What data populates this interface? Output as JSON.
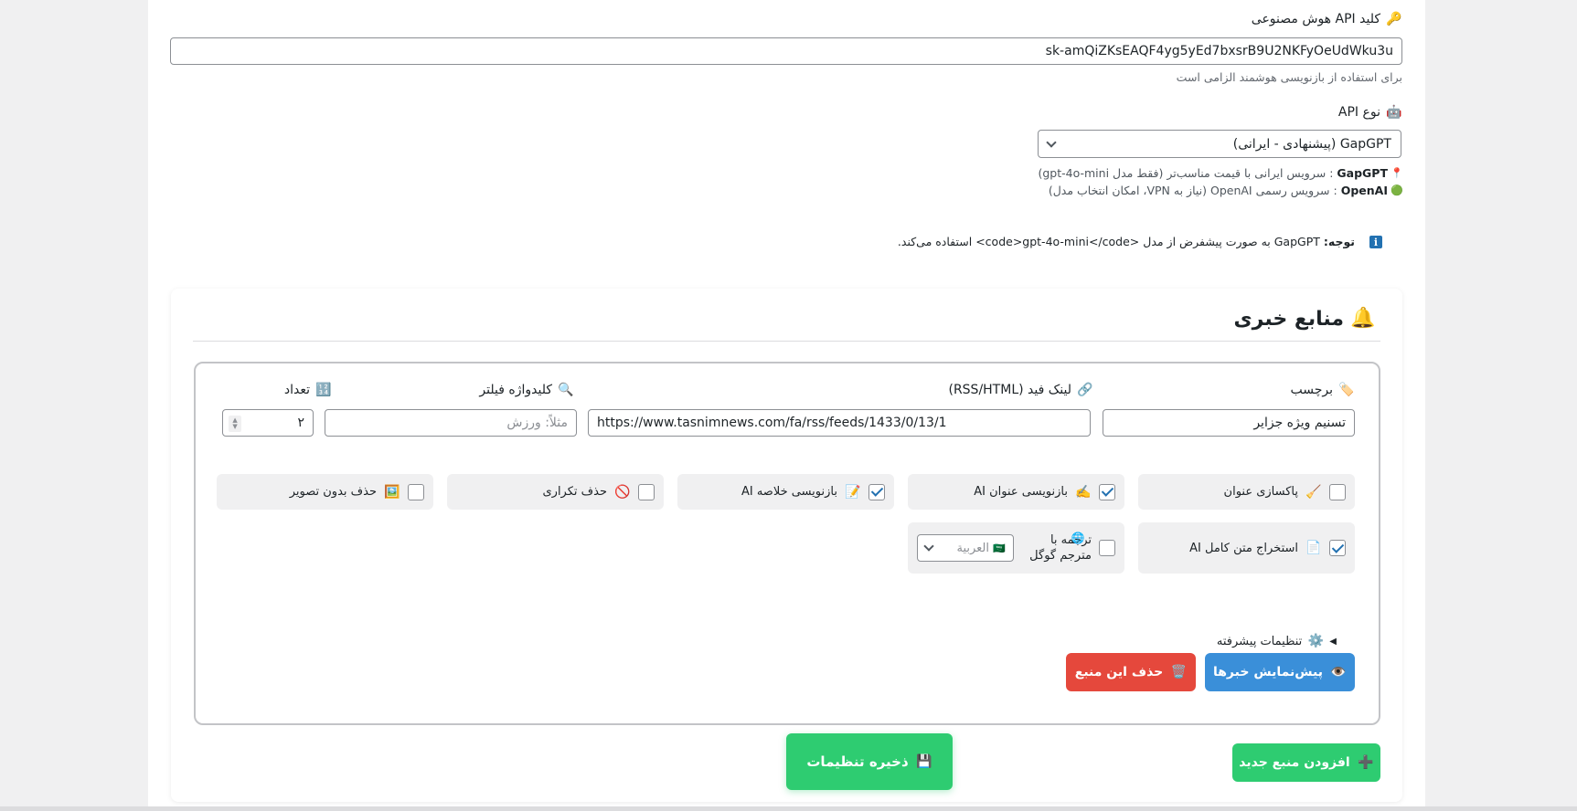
{
  "api_key": {
    "label": "کلید API هوش مصنوعی",
    "icon": "key-icon",
    "value": "sk-amQiZKsEAQF4yg5yEd7bxsrB9U2NKFyOeUdWku3u",
    "help": "برای استفاده از بازنویسی هوشمند الزامی است"
  },
  "api_type": {
    "label": "نوع API",
    "icon": "robot-icon",
    "selected": "GapGPT (پیشنهادی - ایرانی)",
    "notes": [
      {
        "name": "GapGPT",
        "text": ": سرویس ایرانی با قیمت مناسب‌تر (فقط مدل gpt-4o-mini)"
      },
      {
        "name": "OpenAI",
        "text": ": سرویس رسمی OpenAI (نیاز به VPN، امکان انتخاب مدل)"
      }
    ]
  },
  "notice": {
    "bold": "توجه:",
    "text": " GapGPT به صورت پیشفرض از مدل <code>gpt-4o-mini</code> استفاده می‌کند."
  },
  "sources": {
    "title": "منابع خبری",
    "fields": {
      "tag_label": "برچسب",
      "tag_value": "تسنیم ویژه جزایر",
      "feed_label": "لینک فید (RSS/HTML)",
      "feed_value": "https://www.tasnimnews.com/fa/rss/feeds/1433/0/13/1",
      "keyword_label": "کلیدواژه فیلتر",
      "keyword_placeholder": "مثلاً: ورزش",
      "count_label": "تعداد",
      "count_value": "۲"
    },
    "options": [
      {
        "label": "پاکسازی عنوان",
        "checked": false
      },
      {
        "label": "بازنویسی عنوان AI",
        "checked": true
      },
      {
        "label": "بازنویسی خلاصه AI",
        "checked": true
      },
      {
        "label": "حذف تکراری",
        "checked": false
      },
      {
        "label": "حذف بدون تصویر",
        "checked": false
      },
      {
        "label": "استخراج متن کامل AI",
        "checked": true
      },
      {
        "label": "ترجمه با مترجم گوگل",
        "checked": false
      }
    ],
    "translate_language": "العربية",
    "advanced_label": "تنظیمات پیشرفته",
    "preview_button": "پیش‌نمایش خبرها",
    "delete_button": "حذف این منبع"
  },
  "footer": {
    "add_source_button": "افزودن منبع جدید",
    "save_button": "ذخیره تنظیمات"
  },
  "colors": {
    "accent_blue": "#3a8fd9",
    "danger_red": "#e5483c",
    "success_green": "#2ecc71",
    "checkbox_blue": "#2271b1"
  }
}
